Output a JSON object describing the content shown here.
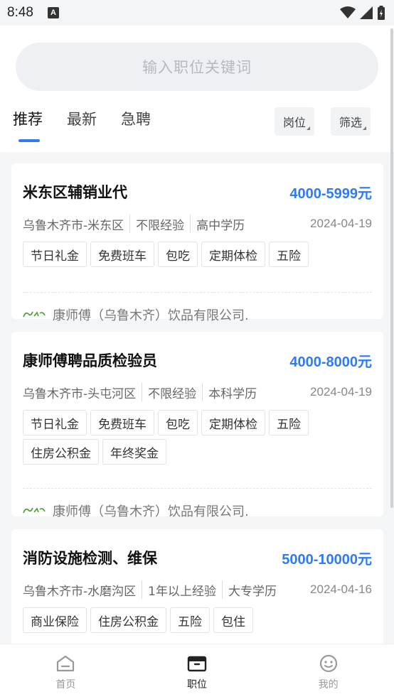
{
  "status": {
    "time": "8:48",
    "notif": "A"
  },
  "search": {
    "placeholder": "输入职位关键词"
  },
  "tabs": [
    {
      "label": "推荐",
      "active": true
    },
    {
      "label": "最新",
      "active": false
    },
    {
      "label": "急聘",
      "active": false
    }
  ],
  "filters": {
    "position_label": "岗位",
    "filter_label": "筛选"
  },
  "jobs": [
    {
      "title": "米东区辅销业代",
      "salary": "4000-5999元",
      "location": "乌鲁木齐市-米东区",
      "experience": "不限经验",
      "education": "高中学历",
      "date": "2024-04-19",
      "tags": [
        "节日礼金",
        "免费班车",
        "包吃",
        "定期体检",
        "五险"
      ],
      "company": "康师傅（乌鲁木齐）饮品有限公司."
    },
    {
      "title": "康师傅聘品质检验员",
      "salary": "4000-8000元",
      "location": "乌鲁木齐市-头屯河区",
      "experience": "不限经验",
      "education": "本科学历",
      "date": "2024-04-19",
      "tags": [
        "节日礼金",
        "免费班车",
        "包吃",
        "定期体检",
        "五险",
        "住房公积金",
        "年终奖金"
      ],
      "company": "康师傅（乌鲁木齐）饮品有限公司."
    },
    {
      "title": "消防设施检测、维保",
      "salary": "5000-10000元",
      "location": "乌鲁木齐市-水磨沟区",
      "experience": "1年以上经验",
      "education": "大专学历",
      "date": "2024-04-16",
      "tags": [
        "商业保险",
        "住房公积金",
        "五险",
        "包住"
      ],
      "company": ""
    }
  ],
  "nav": [
    {
      "label": "首页",
      "icon": "home-icon",
      "active": false
    },
    {
      "label": "职位",
      "icon": "briefcase-icon",
      "active": true
    },
    {
      "label": "我的",
      "icon": "smiley-icon",
      "active": false
    }
  ],
  "colors": {
    "accent": "#2f7bf5",
    "logo": "#4a9a2a"
  }
}
